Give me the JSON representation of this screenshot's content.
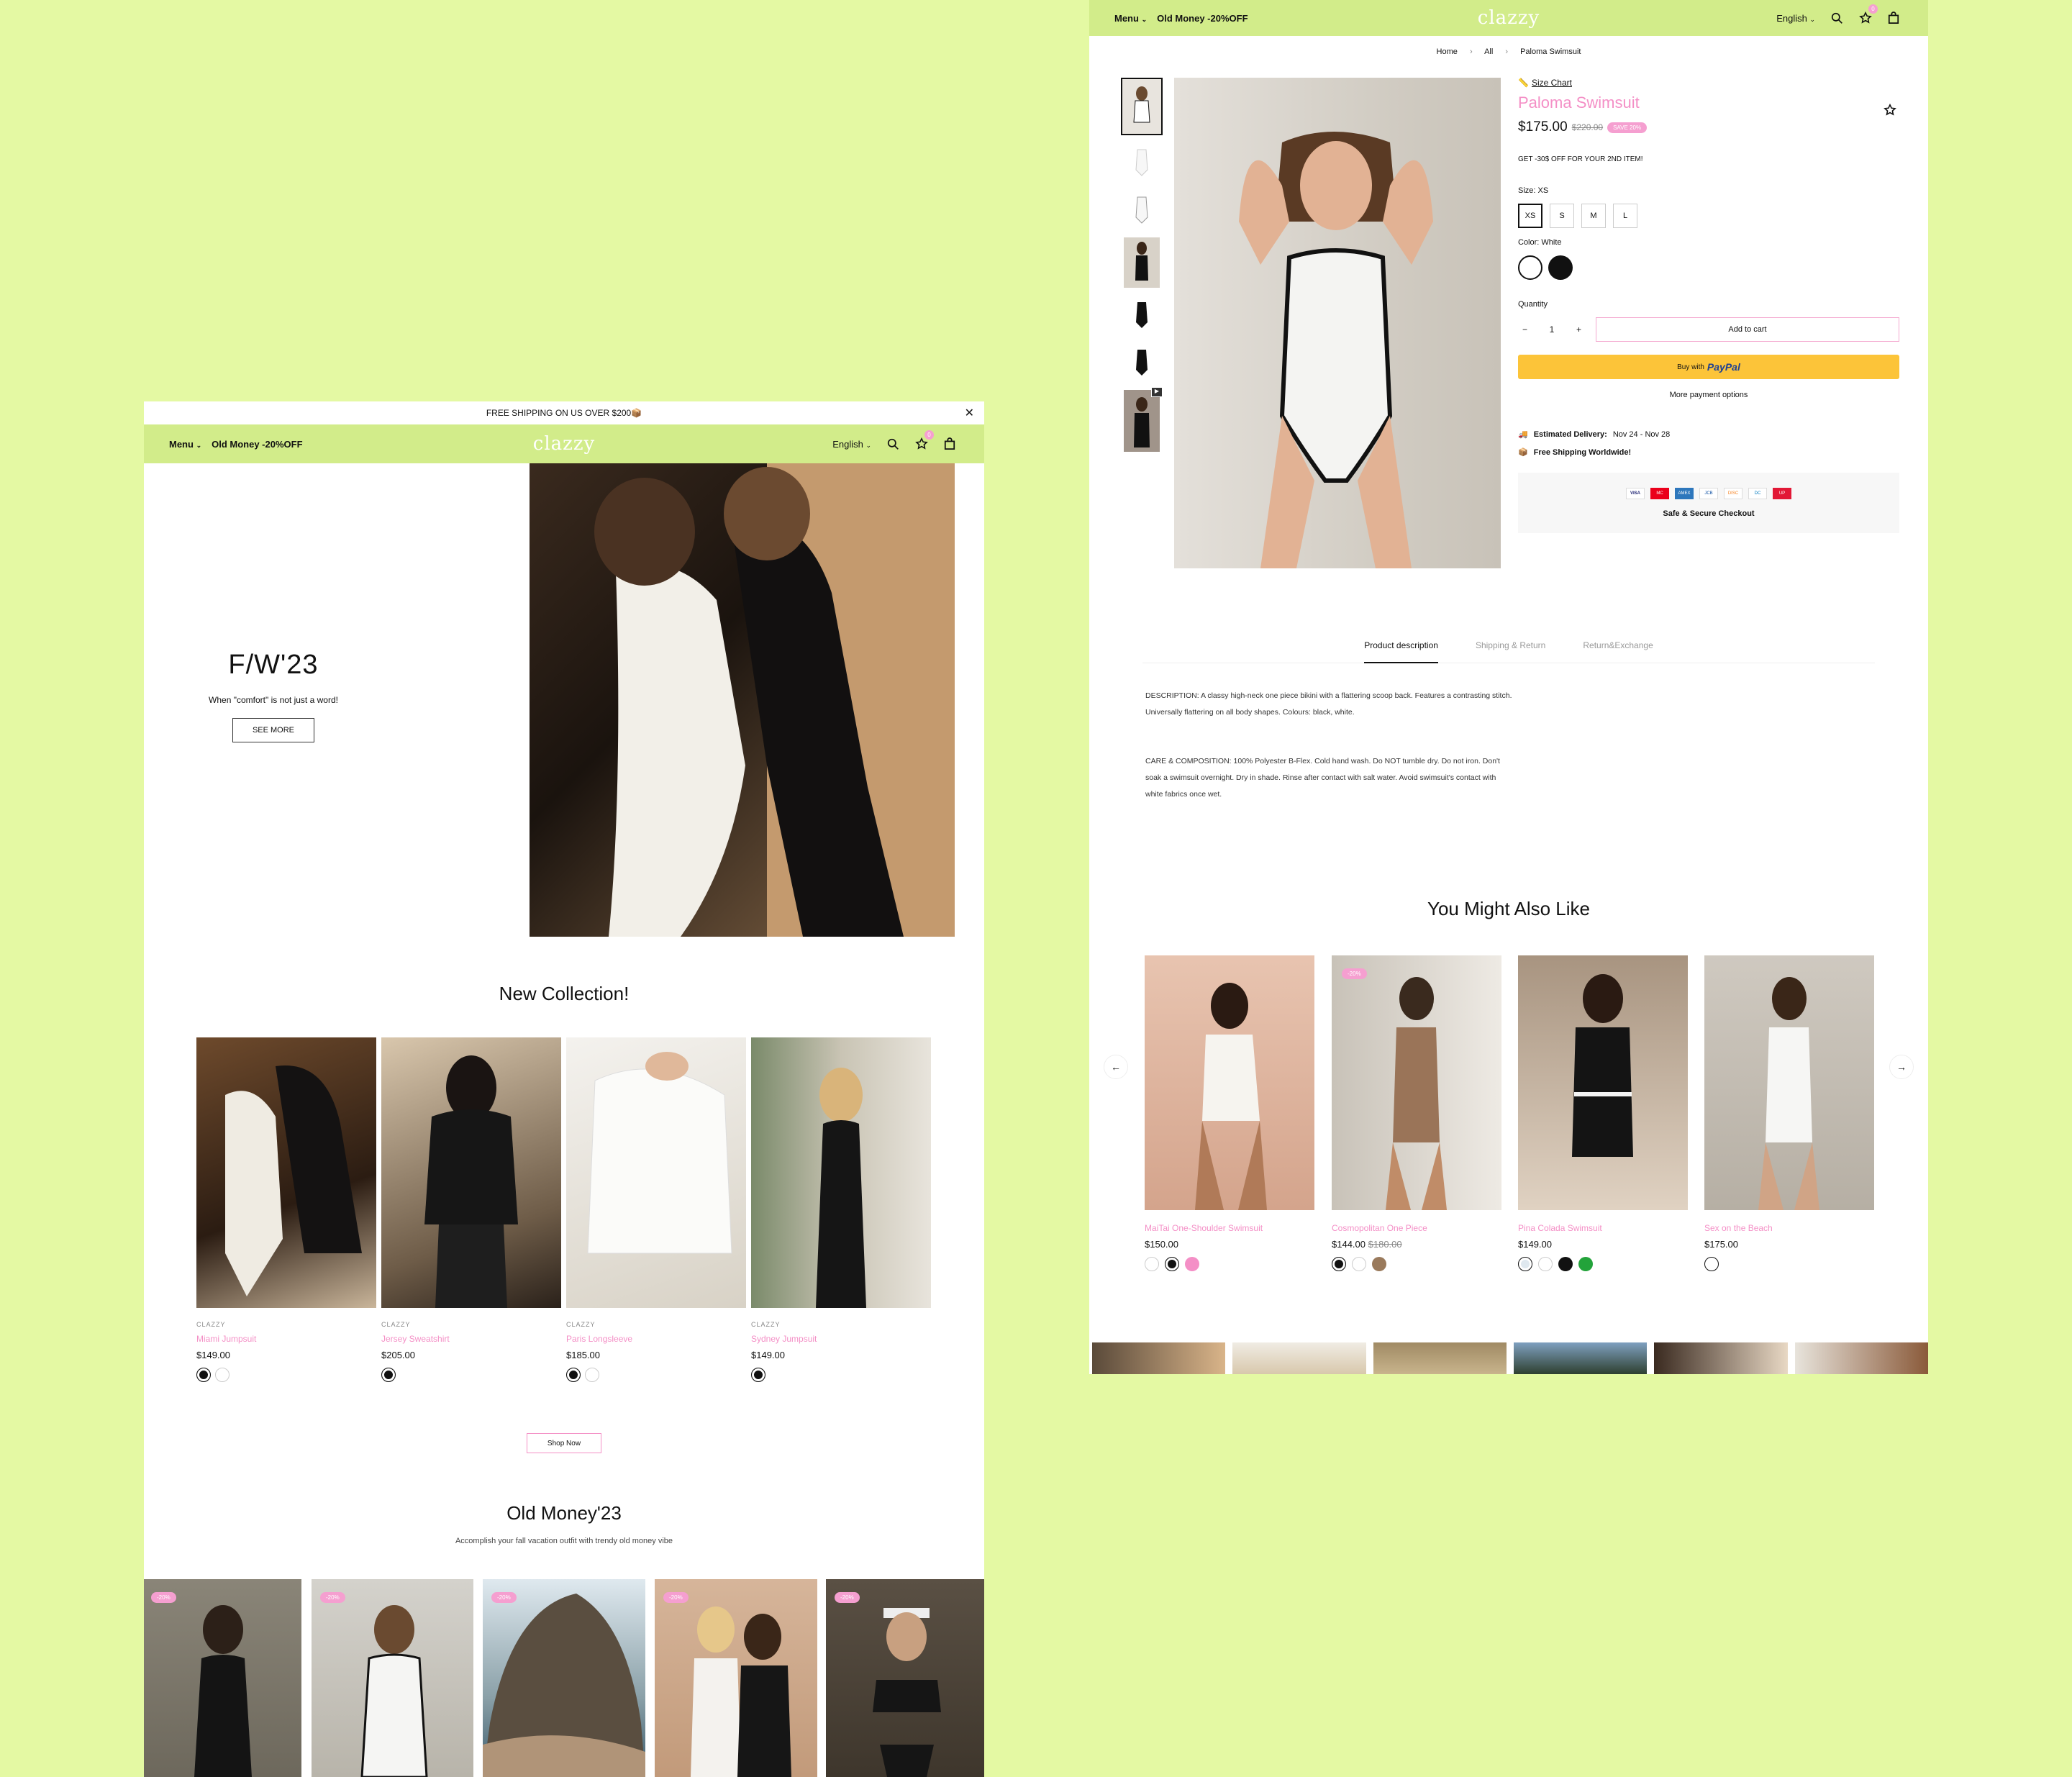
{
  "home": {
    "announcement": "FREE SHIPPING ON US OVER $200📦",
    "nav": {
      "menu": "Menu",
      "promo": "Old Money -20%OFF",
      "logo": "clazzy",
      "language": "English",
      "wishlist_count": "0"
    },
    "hero": {
      "title": "F/W'23",
      "subtitle": "When \"comfort\" is not just a word!",
      "button": "SEE MORE"
    },
    "new_collection": {
      "title": "New Collection!",
      "products": [
        {
          "brand": "CLAZZY",
          "name": "Miami Jumpsuit",
          "price": "$149.00",
          "swatches": [
            "#111111",
            "#ffffff"
          ]
        },
        {
          "brand": "CLAZZY",
          "name": "Jersey Sweatshirt",
          "price": "$205.00",
          "swatches": [
            "#111111"
          ]
        },
        {
          "brand": "CLAZZY",
          "name": "Paris Longsleeve",
          "price": "$185.00",
          "swatches": [
            "#111111",
            "#ffffff"
          ]
        },
        {
          "brand": "CLAZZY",
          "name": "Sydney Jumpsuit",
          "price": "$149.00",
          "swatches": [
            "#111111"
          ]
        }
      ],
      "shop_now": "Shop Now"
    },
    "old_money": {
      "title": "Old Money'23",
      "subtitle": "Accomplish your fall vacation outfit with trendy old money vibe",
      "tag": "-20%"
    }
  },
  "product": {
    "nav": {
      "menu": "Menu",
      "promo": "Old Money -20%OFF",
      "logo": "clazzy",
      "language": "English",
      "wishlist_count": "0"
    },
    "breadcrumb": [
      "Home",
      "All",
      "Paloma Swimsuit"
    ],
    "size_chart": "Size Chart",
    "title": "Paloma Swimsuit",
    "price": "$175.00",
    "compare_price": "$220.00",
    "save_badge": "SAVE 20%",
    "offer": "GET -30$ OFF FOR YOUR 2ND ITEM!",
    "size_label": "Size:",
    "size_value": "XS",
    "sizes": [
      "XS",
      "S",
      "M",
      "L"
    ],
    "color_label": "Color:",
    "color_value": "White",
    "colors": [
      "#ffffff",
      "#111111"
    ],
    "quantity_label": "Quantity",
    "quantity": "1",
    "add_to_cart": "Add to cart",
    "buy_with": "Buy with",
    "paypal": "PayPal",
    "more_payment": "More payment options",
    "delivery_label": "Estimated Delivery:",
    "delivery_value": "Nov 24 - Nov 28",
    "free_shipping": "Free Shipping Worldwide!",
    "payment_cards": [
      "VISA",
      "MC",
      "AMEX",
      "JCB",
      "DISC",
      "DC",
      "UP"
    ],
    "secure": "Safe & Secure Checkout",
    "tabs": [
      "Product description",
      "Shipping & Return",
      "Return&Exchange"
    ],
    "description": "DESCRIPTION: A classy high-neck one piece bikini with a flattering scoop back. Features a contrasting stitch. Universally flattering on all body shapes. Colours: black, white.",
    "care": "CARE & COMPOSITION: 100% Polyester B-Flex. Cold hand wash. Do NOT tumble dry. Do not iron. Don't soak a swimsuit overnight. Dry in shade. Rinse after contact with salt water. Avoid swimsuit's contact with white fabrics once wet.",
    "related_title": "You Might Also Like",
    "related": [
      {
        "name": "MaiTai One-Shoulder Swimsuit",
        "price": "$150.00",
        "compare": "",
        "tag": "",
        "swatches": [
          "#ffffff",
          "#111111",
          "#f48fc6"
        ]
      },
      {
        "name": "Cosmopolitan One Piece",
        "price": "$144.00",
        "compare": "$180.00",
        "tag": "-20%",
        "swatches": [
          "#111111",
          "#ffffff",
          "#9a7a5c"
        ]
      },
      {
        "name": "Pina Colada Swimsuit",
        "price": "$149.00",
        "compare": "",
        "tag": "",
        "swatches": [
          "#dfe8ef",
          "#ffffff",
          "#111111",
          "#23a33a"
        ]
      },
      {
        "name": "Sex on the Beach",
        "price": "$175.00",
        "compare": "",
        "tag": "",
        "swatches": [
          "#ffffff"
        ]
      }
    ]
  }
}
